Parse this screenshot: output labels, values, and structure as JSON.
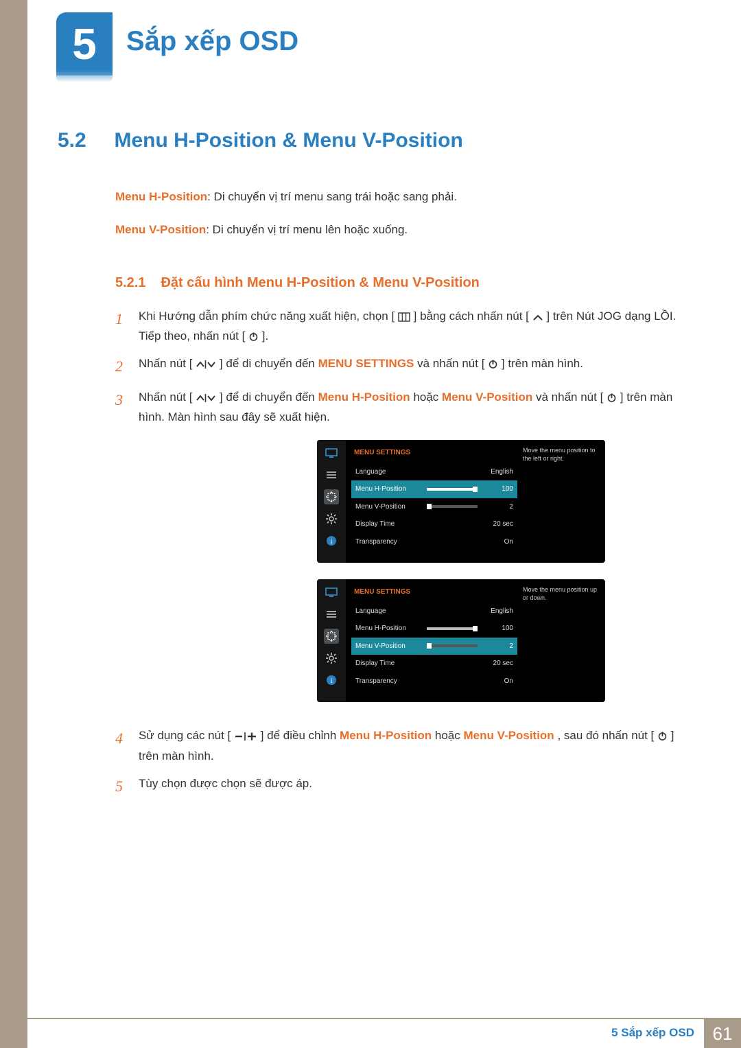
{
  "chapter": {
    "number": "5",
    "title": "Sắp xếp OSD"
  },
  "section": {
    "number": "5.2",
    "title": "Menu H-Position & Menu V-Position"
  },
  "desc": {
    "h_term": "Menu H-Position",
    "h_text": ": Di chuyển vị trí menu sang trái hoặc sang phải.",
    "v_term": "Menu V-Position",
    "v_text": ": Di chuyển vị trí menu lên hoặc xuống."
  },
  "subsection": {
    "number": "5.2.1",
    "title": "Đặt cấu hình Menu H-Position & Menu V-Position"
  },
  "steps": {
    "s1a": "Khi Hướng dẫn phím chức năng xuất hiện, chọn [",
    "s1b": "] bằng cách nhấn nút [",
    "s1c": "] trên Nút JOG dạng LỒI.",
    "s1d": "Tiếp theo, nhấn nút [",
    "s1e": "].",
    "s2a": "Nhấn nút [",
    "s2b": "] để di chuyển đến ",
    "s2kw": "MENU SETTINGS",
    "s2c": " và nhấn nút [",
    "s2d": "] trên màn hình.",
    "s3a": "Nhấn nút [",
    "s3b": "] để di chuyển đến ",
    "s3kw1": "Menu H-Position",
    "s3mid": " hoặc ",
    "s3kw2": "Menu V-Position",
    "s3c": " và nhấn nút [",
    "s3d": "] trên màn hình. Màn hình sau đây sẽ xuất hiện.",
    "s4a": "Sử dụng các nút [",
    "s4b": "] để điều chỉnh ",
    "s4kw1": "Menu H-Position",
    "s4mid": " hoặc ",
    "s4kw2": "Menu V-Position",
    "s4c": ", sau đó nhấn nút [",
    "s4d": "] trên màn hình.",
    "s5": "Tùy chọn được chọn sẽ được áp."
  },
  "osd_head": "MENU SETTINGS",
  "osd_rows": {
    "language": "Language",
    "h": "Menu H-Position",
    "v": "Menu V-Position",
    "dt": "Display Time",
    "tr": "Transparency",
    "language_val": "English",
    "h_val": "100",
    "v_val": "2",
    "dt_val": "20 sec",
    "tr_val": "On"
  },
  "osd_hint_h": "Move the menu position to the left or right.",
  "osd_hint_v": "Move the menu position up or down.",
  "footer": {
    "label": "5 Sắp xếp OSD",
    "page": "61"
  },
  "chart_data": {
    "type": "table",
    "title": "MENU SETTINGS OSD values",
    "rows": [
      {
        "label": "Language",
        "value": "English"
      },
      {
        "label": "Menu H-Position",
        "value": 100,
        "range": [
          0,
          100
        ]
      },
      {
        "label": "Menu V-Position",
        "value": 2,
        "range": [
          0,
          100
        ]
      },
      {
        "label": "Display Time",
        "value": "20 sec"
      },
      {
        "label": "Transparency",
        "value": "On"
      }
    ]
  }
}
